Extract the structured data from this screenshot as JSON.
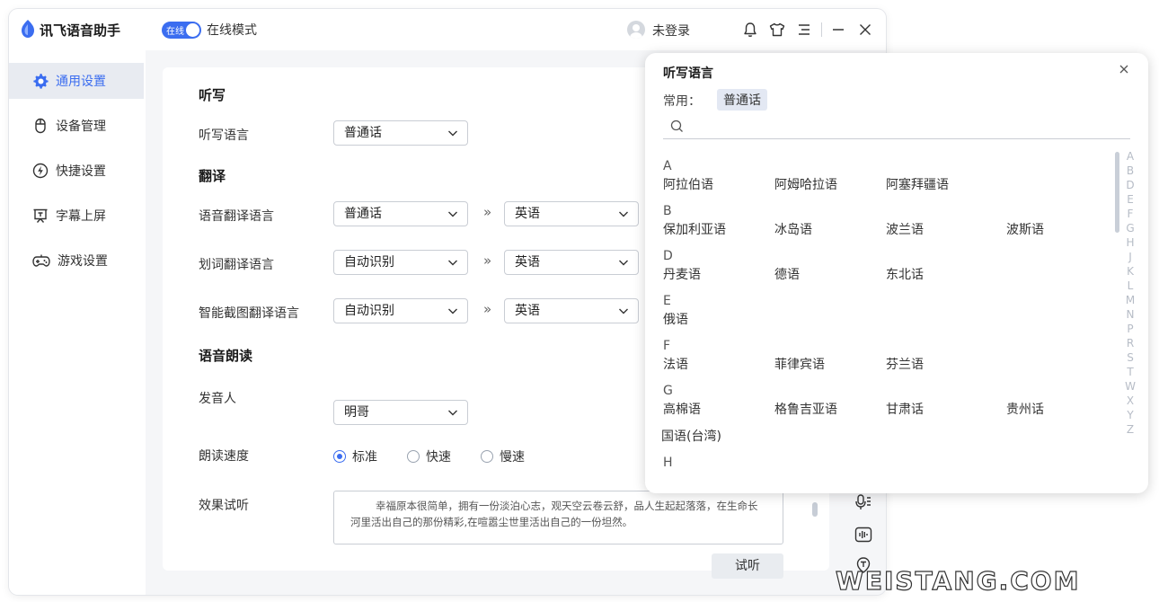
{
  "app": {
    "title": "讯飞语音助手",
    "toggle_text": "在线",
    "mode_label": "在线模式",
    "login_text": "未登录"
  },
  "sidebar": {
    "items": [
      {
        "label": "通用设置",
        "icon": "gear-icon",
        "active": true
      },
      {
        "label": "设备管理",
        "icon": "mouse-icon"
      },
      {
        "label": "快捷设置",
        "icon": "lightning-icon"
      },
      {
        "label": "字幕上屏",
        "icon": "screen-icon"
      },
      {
        "label": "游戏设置",
        "icon": "gamepad-icon"
      }
    ]
  },
  "settings": {
    "dictation": {
      "title": "听写",
      "language_label": "听写语言",
      "language_value": "普通话"
    },
    "translation": {
      "title": "翻译",
      "voice_label": "语音翻译语言",
      "voice_from": "普通话",
      "voice_to": "英语",
      "word_label": "划词翻译语言",
      "word_from": "自动识别",
      "word_to": "英语",
      "screenshot_label": "智能截图翻译语言",
      "screenshot_from": "自动识别",
      "screenshot_to": "英语",
      "arrow": "»"
    },
    "reading": {
      "title": "语音朗读",
      "speaker_label": "发音人",
      "speaker_value": "明哥",
      "speed_label": "朗读速度",
      "speed_options": [
        "标准",
        "快速",
        "慢速"
      ],
      "speed_selected": "标准",
      "preview_label": "效果试听",
      "preview_text": "幸福原本很简单，拥有一份淡泊心志，观天空云卷云舒，品人生起起落落，在生命长河里活出自己的那份精彩,在喧嚣尘世里活出自己的一份坦然。",
      "listen_button": "试听"
    }
  },
  "panel": {
    "title": "听写语言",
    "common_label": "常用：",
    "common_value": "普通话",
    "search_placeholder": "",
    "groups": [
      {
        "letter": "A",
        "items": [
          "阿拉伯语",
          "阿姆哈拉语",
          "阿塞拜疆语"
        ]
      },
      {
        "letter": "B",
        "items": [
          "保加利亚语",
          "冰岛语",
          "波兰语",
          "波斯语"
        ]
      },
      {
        "letter": "D",
        "items": [
          "丹麦语",
          "德语",
          "东北话"
        ]
      },
      {
        "letter": "E",
        "items": [
          "俄语"
        ]
      },
      {
        "letter": "F",
        "items": [
          "法语",
          "菲律宾语",
          "芬兰语"
        ]
      },
      {
        "letter": "G",
        "items": [
          "高棉语",
          "格鲁吉亚语",
          "甘肃话",
          "贵州话"
        ]
      },
      {
        "letter": "",
        "items": [
          "国语(台湾)"
        ]
      },
      {
        "letter": "H",
        "items": []
      }
    ],
    "alphabet": [
      "A",
      "B",
      "D",
      "E",
      "F",
      "G",
      "H",
      "J",
      "K",
      "L",
      "M",
      "N",
      "P",
      "R",
      "S",
      "T",
      "W",
      "X",
      "Y",
      "Z"
    ]
  },
  "watermark": "WEISTANG.COM",
  "colors": {
    "accent": "#3b6df0",
    "active_bg": "#e8ebf1"
  }
}
